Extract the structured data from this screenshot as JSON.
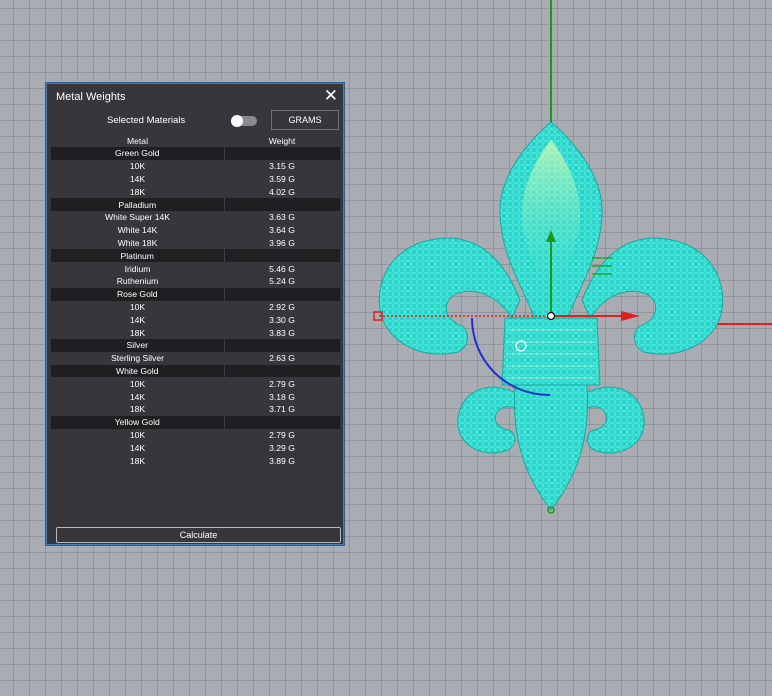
{
  "panel": {
    "title": "Metal Weights",
    "close_icon": "close-icon",
    "selected_materials_label": "Selected Materials",
    "toggle_state": "off",
    "units_button": "GRAMS",
    "columns": {
      "metal": "Metal",
      "weight": "Weight"
    },
    "groups": [
      {
        "name": "Green Gold",
        "rows": [
          {
            "metal": "10K",
            "weight": "3.15 G"
          },
          {
            "metal": "14K",
            "weight": "3.59 G"
          },
          {
            "metal": "18K",
            "weight": "4.02 G"
          }
        ]
      },
      {
        "name": "Palladium",
        "rows": [
          {
            "metal": "White Super 14K",
            "weight": "3.63 G"
          },
          {
            "metal": "White 14K",
            "weight": "3.64 G"
          },
          {
            "metal": "White 18K",
            "weight": "3.96 G"
          }
        ]
      },
      {
        "name": "Platinum",
        "rows": [
          {
            "metal": "Iridium",
            "weight": "5.46 G"
          },
          {
            "metal": "Ruthenium",
            "weight": "5.24 G"
          }
        ]
      },
      {
        "name": "Rose Gold",
        "rows": [
          {
            "metal": "10K",
            "weight": "2.92 G"
          },
          {
            "metal": "14K",
            "weight": "3.30 G"
          },
          {
            "metal": "18K",
            "weight": "3.83 G"
          }
        ]
      },
      {
        "name": "Silver",
        "rows": [
          {
            "metal": "Sterling Silver",
            "weight": "2.63 G"
          }
        ]
      },
      {
        "name": "White Gold",
        "rows": [
          {
            "metal": "10K",
            "weight": "2.79 G"
          },
          {
            "metal": "14K",
            "weight": "3.18 G"
          },
          {
            "metal": "18K",
            "weight": "3.71 G"
          }
        ]
      },
      {
        "name": "Yellow Gold",
        "rows": [
          {
            "metal": "10K",
            "weight": "2.79 G"
          },
          {
            "metal": "14K",
            "weight": "3.29 G"
          },
          {
            "metal": "18K",
            "weight": "3.89 G"
          }
        ]
      }
    ],
    "calculate_button": "Calculate"
  },
  "colors": {
    "viewport_bg": "#a9adb3",
    "panel_bg": "#36363b",
    "group_header_bg": "#1f1f22",
    "model_wire": "#32e0d4",
    "axis_x": "#e02020",
    "axis_y": "#1a9a1a",
    "gumball_rotate": "#1f2fd0"
  }
}
